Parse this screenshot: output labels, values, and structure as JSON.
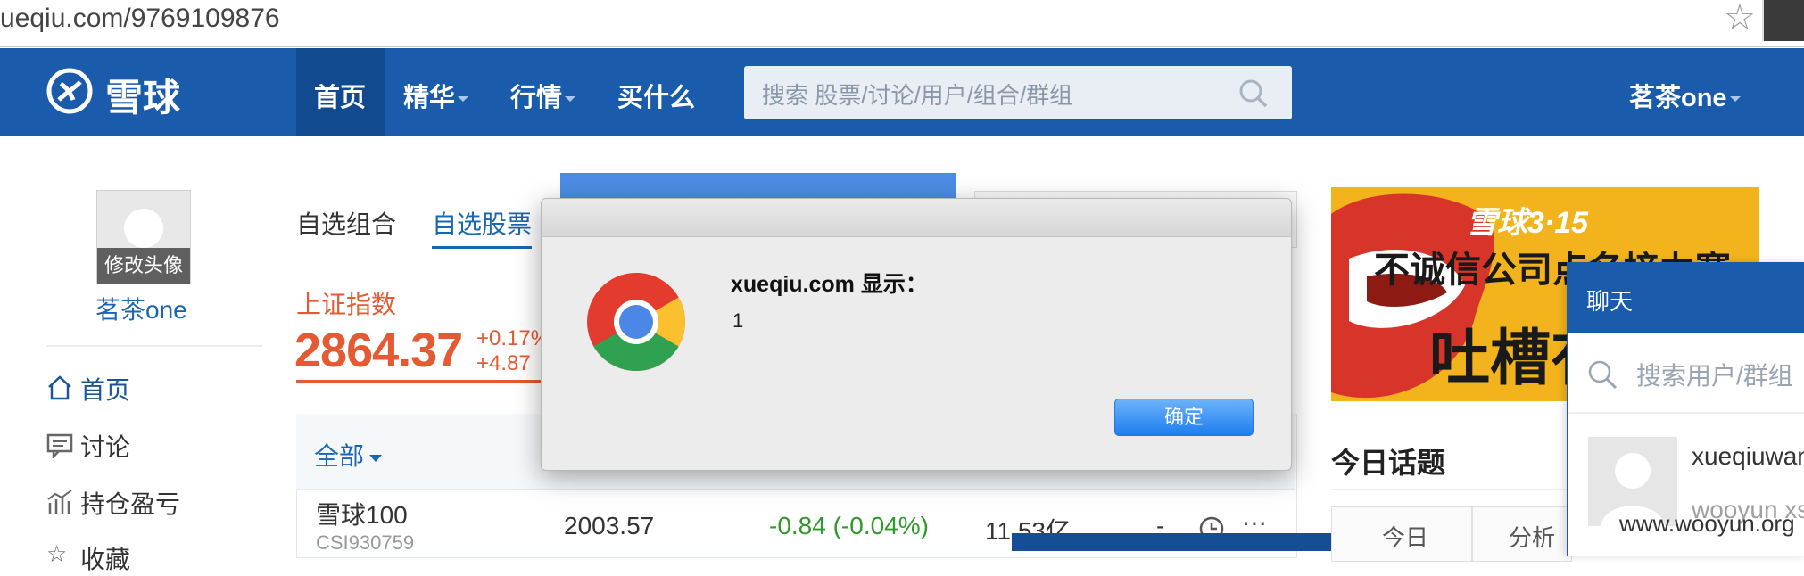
{
  "browser": {
    "url": "ueqiu.com/9769109876"
  },
  "nav": {
    "logo_text": "雪球",
    "items": [
      {
        "label": "首页",
        "active": true,
        "dropdown": false
      },
      {
        "label": "精华",
        "active": false,
        "dropdown": true
      },
      {
        "label": "行情",
        "active": false,
        "dropdown": true
      },
      {
        "label": "买什么",
        "active": false,
        "dropdown": false
      }
    ],
    "search_placeholder": "搜索 股票/讨论/用户/组合/群组",
    "user_label": "茗茶one"
  },
  "profile": {
    "avatar_caption": "修改头像",
    "username": "茗茶one",
    "menu": [
      {
        "label": "首页",
        "icon": "home-icon"
      },
      {
        "label": "讨论",
        "icon": "comment-icon"
      },
      {
        "label": "持仓盈亏",
        "icon": "chart-icon"
      },
      {
        "label": "收藏",
        "icon": "star-icon"
      }
    ]
  },
  "tabs": [
    {
      "label": "自选组合",
      "active": false
    },
    {
      "label": "自选股票",
      "active": true
    }
  ],
  "index": {
    "name": "上证指数",
    "value": "2864.37",
    "change_pct": "+0.17%",
    "change_pts": "+4.87"
  },
  "stock_table": {
    "filter_label": "全部",
    "rows": [
      {
        "name": "雪球100",
        "code": "CSI930759",
        "price": "2003.57",
        "change": "-0.84 (-0.04%)",
        "volume": "11.53亿",
        "extra": "-"
      }
    ]
  },
  "dialog": {
    "title": "xueqiu.com 显示：",
    "message": "1",
    "ok_label": "确定"
  },
  "ad": {
    "line1": "雪球3·15",
    "line2": "不诚信公司点名接力赛",
    "line3": "吐槽有"
  },
  "topics": {
    "title": "今日话题",
    "tabs": [
      "今日",
      "分析"
    ]
  },
  "chat": {
    "title": "聊天",
    "search_placeholder": "搜索用户/群组",
    "user": "xueqiuwan",
    "sub": "wooyun xs"
  },
  "watermark": "www.wooyun.org",
  "colors": {
    "nav_bg": "#1b5bab",
    "accent_red": "#e45a32",
    "accent_green": "#2f9a2a",
    "link_blue": "#1b66b0"
  }
}
